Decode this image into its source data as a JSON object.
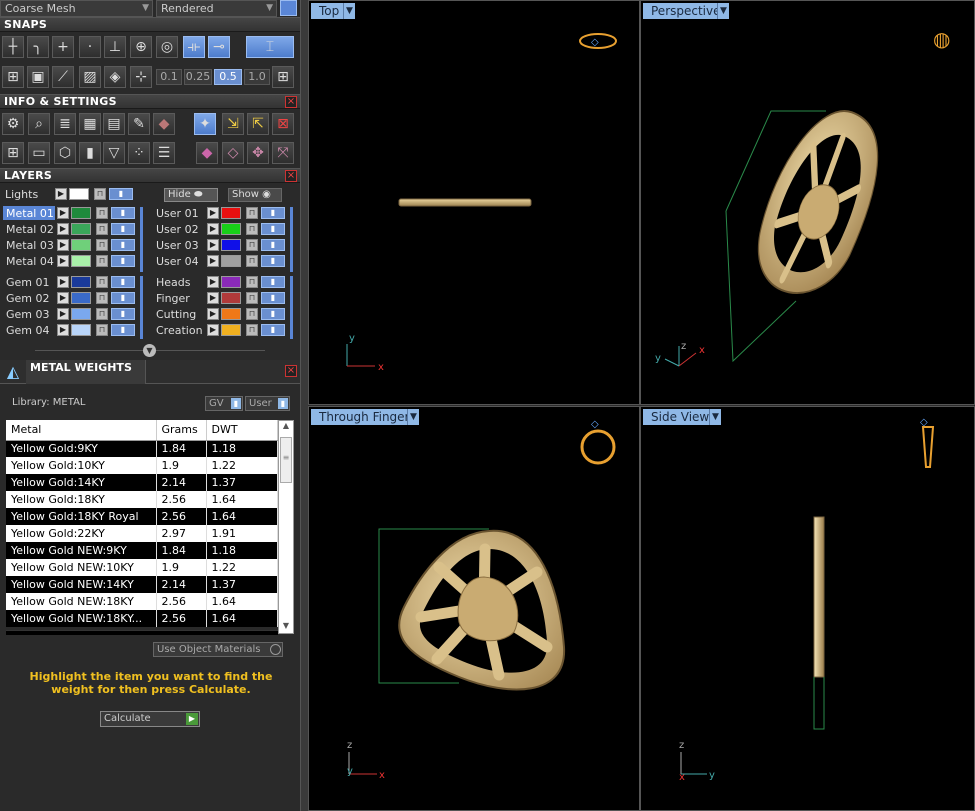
{
  "top_bar": {
    "mesh": "Coarse Mesh",
    "render": "Rendered"
  },
  "snaps": {
    "title": "SNAPS",
    "values": [
      "0.1",
      "0.25",
      "0.5",
      "1.0"
    ]
  },
  "info": {
    "title": "INFO & SETTINGS"
  },
  "layers": {
    "title": "LAYERS",
    "lights": "Lights",
    "hide": "Hide",
    "show": "Show",
    "left": [
      {
        "name": "Metal 01",
        "color": "#1f8a3c"
      },
      {
        "name": "Metal 02",
        "color": "#3aa65a"
      },
      {
        "name": "Metal 03",
        "color": "#6fd07a"
      },
      {
        "name": "Metal 04",
        "color": "#a9f0a9"
      },
      {
        "name": "Gem 01",
        "color": "#1a3a9a"
      },
      {
        "name": "Gem 02",
        "color": "#3a6ac8"
      },
      {
        "name": "Gem 03",
        "color": "#7aa8ee"
      },
      {
        "name": "Gem 04",
        "color": "#b8d4f8"
      }
    ],
    "right": [
      {
        "name": "User 01",
        "color": "#e81010"
      },
      {
        "name": "User 02",
        "color": "#18d018"
      },
      {
        "name": "User 03",
        "color": "#1010e8"
      },
      {
        "name": "User 04",
        "color": "#a0a0a0"
      },
      {
        "name": "Heads",
        "color": "#8a2ab8"
      },
      {
        "name": "Finger",
        "color": "#b03a3a"
      },
      {
        "name": "Cutting",
        "color": "#f07818"
      },
      {
        "name": "Creation",
        "color": "#f0b020"
      }
    ]
  },
  "weights": {
    "title": "METAL WEIGHTS",
    "library": "Library: METAL",
    "gv": "GV",
    "user": "User",
    "columns": [
      "Metal",
      "Grams",
      "DWT"
    ],
    "rows": [
      [
        "Yellow Gold:9KY",
        "1.84",
        "1.18"
      ],
      [
        "Yellow Gold:10KY",
        "1.9",
        "1.22"
      ],
      [
        "Yellow Gold:14KY",
        "2.14",
        "1.37"
      ],
      [
        "Yellow Gold:18KY",
        "2.56",
        "1.64"
      ],
      [
        "Yellow Gold:18KY Royal",
        "2.56",
        "1.64"
      ],
      [
        "Yellow Gold:22KY",
        "2.97",
        "1.91"
      ],
      [
        "Yellow Gold NEW:9KY",
        "1.84",
        "1.18"
      ],
      [
        "Yellow Gold NEW:10KY",
        "1.9",
        "1.22"
      ],
      [
        "Yellow Gold NEW:14KY",
        "2.14",
        "1.37"
      ],
      [
        "Yellow Gold NEW:18KY",
        "2.56",
        "1.64"
      ],
      [
        "Yellow Gold NEW:18KY...",
        "2.56",
        "1.64"
      ]
    ],
    "use_object": "Use Object Materials",
    "hint": "Highlight the item you want to find the weight for then press Calculate.",
    "calculate": "Calculate"
  },
  "viewports": {
    "top": "Top",
    "perspective": "Perspective",
    "through_finger": "Through Finger",
    "side_view": "Side View"
  },
  "colors": {
    "accent": "#8fb8e6",
    "gold": "#d9c08a",
    "hint": "#f0c020"
  }
}
